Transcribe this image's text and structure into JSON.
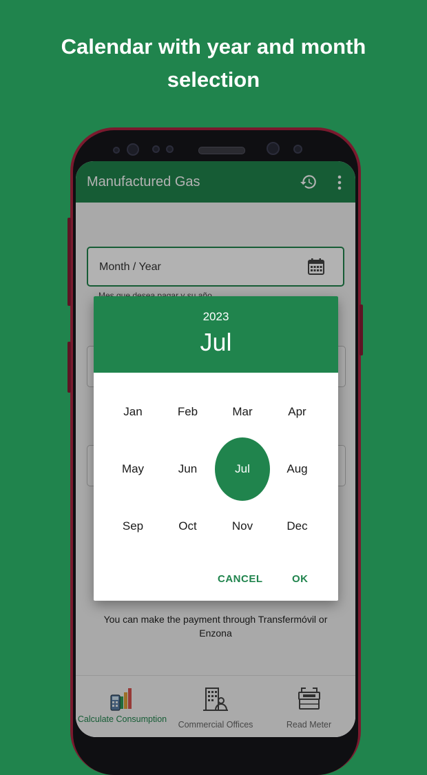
{
  "headline": {
    "line1": "Calendar with year and month",
    "line2": "selection"
  },
  "app": {
    "title": "Manufactured Gas",
    "icons": {
      "history": "history-icon",
      "more": "more-vertical-icon"
    }
  },
  "form": {
    "month_year_placeholder": "Month / Year",
    "helper_text": "Mes que desea pagar y su año"
  },
  "payment_note": "You can make the payment through Transfermóvil or Enzona",
  "bottom_nav": {
    "items": [
      {
        "label": "Calculate Consumption",
        "icon": "calculator-chart-icon",
        "active": true
      },
      {
        "label": "Commercial Offices",
        "icon": "office-building-icon",
        "active": false
      },
      {
        "label": "Read Meter",
        "icon": "gas-meter-icon",
        "active": false
      }
    ]
  },
  "picker": {
    "year": "2023",
    "selected_month": "Jul",
    "months": [
      "Jan",
      "Feb",
      "Mar",
      "Apr",
      "May",
      "Jun",
      "Jul",
      "Aug",
      "Sep",
      "Oct",
      "Nov",
      "Dec"
    ],
    "cancel_label": "CANCEL",
    "ok_label": "OK"
  },
  "colors": {
    "brand_green": "#20844d",
    "background": "#20844d"
  }
}
